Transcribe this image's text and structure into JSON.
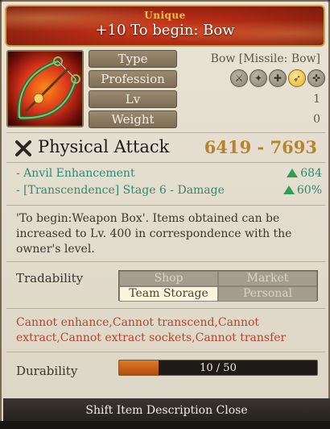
{
  "item": {
    "rarity": "Unique",
    "name": "+10 To begin: Bow"
  },
  "stats": {
    "type_label": "Type",
    "type_value": "Bow [Missile: Bow]",
    "profession_label": "Profession",
    "professions": [
      {
        "icon": "swordsman-icon",
        "active": false
      },
      {
        "icon": "wizard-icon",
        "active": false
      },
      {
        "icon": "cleric-icon",
        "active": false
      },
      {
        "icon": "archer-icon",
        "active": true
      },
      {
        "icon": "scout-icon",
        "active": false
      }
    ],
    "lv_label": "Lv",
    "lv_value": "1",
    "weight_label": "Weight",
    "weight_value": "0"
  },
  "attack": {
    "label": "Physical Attack",
    "value": "6419 - 7693"
  },
  "bonuses": [
    {
      "label": "- Anvil Enhancement",
      "value": "684"
    },
    {
      "label": "- [Transcendence] Stage 6 - Damage",
      "value": "60%"
    }
  ],
  "description": "'To begin:Weapon Box'. Items obtained can be increased to Lv. 400 in correspondence with the owner's level.",
  "tradability": {
    "label": "Tradability",
    "options": [
      {
        "label": "Shop",
        "enabled": false
      },
      {
        "label": "Market",
        "enabled": false
      },
      {
        "label": "Team Storage",
        "enabled": true
      },
      {
        "label": "Personal",
        "enabled": false
      }
    ]
  },
  "restrictions": "Cannot enhance,Cannot transcend,Cannot extract,Cannot extract sockets,Cannot transfer",
  "durability": {
    "label": "Durability",
    "current": 10,
    "max": 50,
    "text": "10 / 50"
  },
  "footer": {
    "text": "Shift Item Description Close"
  },
  "colors": {
    "header_bg": "#b02a14",
    "rarity": "#f0c34a",
    "attack_value": "#b6852a",
    "bonus_text": "#2f8a6e",
    "restriction_text": "#b2452c",
    "durability_fill": "#e07a22"
  }
}
